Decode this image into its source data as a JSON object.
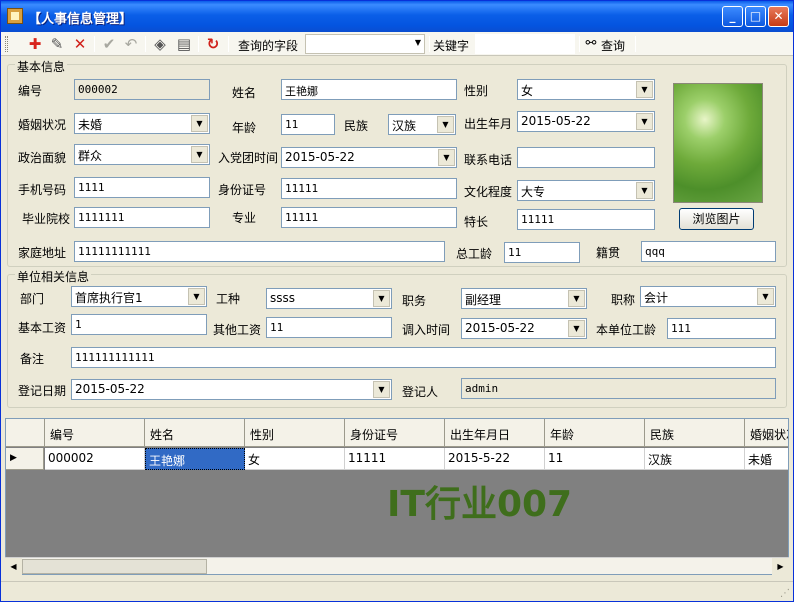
{
  "window": {
    "title": "【人事信息管理】"
  },
  "toolbar": {
    "icons": [
      "add-icon",
      "edit-icon",
      "delete-icon",
      "confirm-icon",
      "undo-icon",
      "clear-icon",
      "print-icon",
      "refresh-icon"
    ],
    "query_field_label": "查询的字段",
    "query_field_value": "",
    "keyword_label": "关键字",
    "keyword_value": "",
    "search_label": "查询"
  },
  "basic": {
    "title": "基本信息",
    "id_label": "编号",
    "id_value": "000002",
    "name_label": "姓名",
    "name_value": "王艳娜",
    "gender_label": "性别",
    "gender_value": "女",
    "marital_label": "婚姻状况",
    "marital_value": "未婚",
    "age_label": "年龄",
    "age_value": "11",
    "ethnic_label": "民族",
    "ethnic_value": "汉族",
    "birth_label": "出生年月",
    "birth_value": "2015-05-22",
    "political_label": "政治面貌",
    "political_value": "群众",
    "join_label": "入党团时间",
    "join_value": "2015-05-22",
    "phone_label": "联系电话",
    "phone_value": "",
    "mobile_label": "手机号码",
    "mobile_value": "1111",
    "idcard_label": "身份证号",
    "idcard_value": "11111",
    "education_label": "文化程度",
    "education_value": "大专",
    "school_label": "毕业院校",
    "school_value": "1111111",
    "major_label": "专业",
    "major_value": "11111",
    "specialty_label": "特长",
    "specialty_value": "11111",
    "address_label": "家庭地址",
    "address_value": "11111111111",
    "total_years_label": "总工龄",
    "total_years_value": "11",
    "native_label": "籍贯",
    "native_value": "qqq",
    "browse_label": "浏览图片"
  },
  "unit": {
    "title": "单位相关信息",
    "dept_label": "部门",
    "dept_value": "首席执行官1",
    "worktype_label": "工种",
    "worktype_value": "ssss",
    "post_label": "职务",
    "post_value": "副经理",
    "rank_label": "职称",
    "rank_value": "会计",
    "salary_label": "基本工资",
    "salary_value": "1",
    "other_salary_label": "其他工资",
    "other_salary_value": "11",
    "transfer_label": "调入时间",
    "transfer_value": "2015-05-22",
    "unit_years_label": "本单位工龄",
    "unit_years_value": "111",
    "remark_label": "备注",
    "remark_value": "111111111111",
    "reg_date_label": "登记日期",
    "reg_date_value": "2015-05-22",
    "registrar_label": "登记人",
    "registrar_value": "admin"
  },
  "grid": {
    "columns": [
      "编号",
      "姓名",
      "性别",
      "身份证号",
      "出生年月日",
      "年龄",
      "民族",
      "婚姻状况"
    ],
    "rows": [
      [
        "000002",
        "王艳娜",
        "女",
        "11111",
        "2015-5-22",
        "11",
        "汉族",
        "未婚"
      ]
    ]
  },
  "watermark": "IT行业007"
}
